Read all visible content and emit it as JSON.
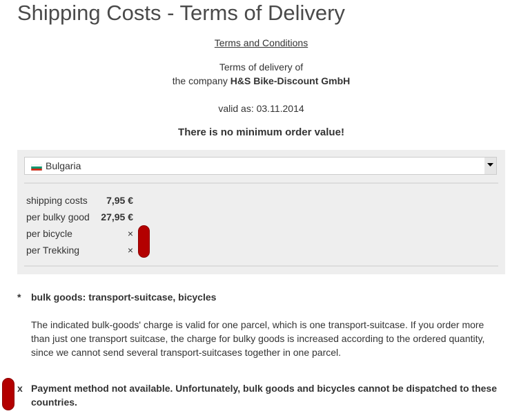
{
  "page": {
    "title": "Shipping Costs - Terms of Delivery",
    "terms_link": "Terms and Conditions",
    "intro_line1": "Terms of delivery of",
    "intro_line2_prefix": "the company",
    "company_name": "H&S Bike-Discount GmbH",
    "valid_as": "valid as: 03.11.2014",
    "min_order_note": "There is no minimum order value!"
  },
  "country_select": {
    "selected": "Bulgaria",
    "flag_icon": "bulgaria-flag-icon",
    "flag_colors": [
      "#ffffff",
      "#00966e",
      "#d62612"
    ]
  },
  "shipping_table": {
    "rows": [
      {
        "label": "shipping costs",
        "value": "7,95 €"
      },
      {
        "label": "per bulky good",
        "value": "27,95 €"
      },
      {
        "label": "per bicycle",
        "value": "×"
      },
      {
        "label": "per Trekking",
        "value": "×"
      }
    ]
  },
  "footnotes": {
    "bulk_marker": "*",
    "bulk_title": "bulk goods: transport-suitcase, bicycles",
    "bulk_text": "The indicated bulk-goods' charge is valid for one parcel, which is one transport-suitcase. If you order more than just one transport suitcase, the charge for bulky goods is increased according to the ordered quantity, since we cannot send several transport-suitcases together in one parcel.",
    "unavailable_marker": "x",
    "unavailable_text": "Payment method not available. Unfortunately, bulk goods and bicycles cannot be dispatched to these countries."
  },
  "colors": {
    "marker_red": "#b30000",
    "panel_bg": "#eeeeee"
  }
}
